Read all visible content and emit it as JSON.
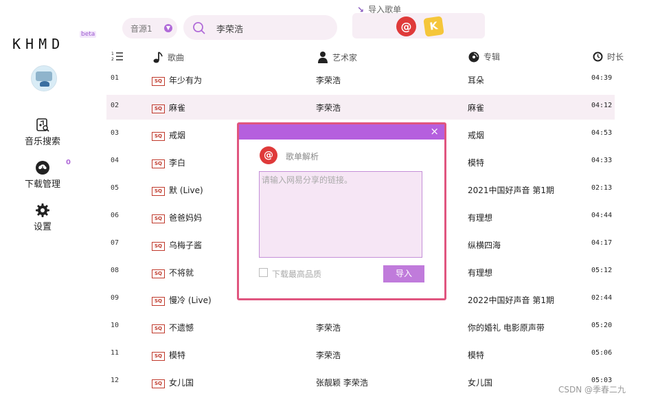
{
  "app": {
    "logo": "KHMD",
    "beta": "beta"
  },
  "sidebar": {
    "items": [
      {
        "label": "音乐搜索",
        "icon": "music-search-icon"
      },
      {
        "label": "下载管理",
        "icon": "cloud-download-icon",
        "badge": "0"
      },
      {
        "label": "设置",
        "icon": "gear-icon"
      }
    ]
  },
  "topbar": {
    "source": "音源1",
    "search_value": "李荣浩",
    "import_label": "导入歌单"
  },
  "table": {
    "headers": {
      "title": "歌曲",
      "artist": "艺术家",
      "album": "专辑",
      "duration": "时长"
    },
    "quality_badge": "SQ",
    "rows": [
      {
        "num": "01",
        "title": "年少有为",
        "artist": "李荣浩",
        "album": "耳朵",
        "duration": "04:39"
      },
      {
        "num": "02",
        "title": "麻雀",
        "artist": "李荣浩",
        "album": "麻雀",
        "duration": "04:12"
      },
      {
        "num": "03",
        "title": "戒烟",
        "artist": "",
        "album": "戒烟",
        "duration": "04:53"
      },
      {
        "num": "04",
        "title": "李白",
        "artist": "",
        "album": "模特",
        "duration": "04:33"
      },
      {
        "num": "05",
        "title": "默 (Live)",
        "artist": "",
        "album": "2021中国好声音 第1期",
        "duration": "02:13"
      },
      {
        "num": "06",
        "title": "爸爸妈妈",
        "artist": "",
        "album": "有理想",
        "duration": "04:44"
      },
      {
        "num": "07",
        "title": "乌梅子酱",
        "artist": "",
        "album": "纵横四海",
        "duration": "04:17"
      },
      {
        "num": "08",
        "title": "不将就",
        "artist": "",
        "album": "有理想",
        "duration": "05:12"
      },
      {
        "num": "09",
        "title": "慢冷 (Live)",
        "artist": "",
        "album": "2022中国好声音 第1期",
        "duration": "02:44"
      },
      {
        "num": "10",
        "title": "不遗憾",
        "artist": "李荣浩",
        "album": "你的婚礼 电影原声带",
        "duration": "05:20"
      },
      {
        "num": "11",
        "title": "模特",
        "artist": "李荣浩",
        "album": "模特",
        "duration": "05:06"
      },
      {
        "num": "12",
        "title": "女儿国",
        "artist": "张靓颖 李荣浩",
        "album": "女儿国",
        "duration": "05:03"
      }
    ]
  },
  "modal": {
    "title": "歌单解析",
    "placeholder": "请输入网易分享的链接。",
    "checkbox_label": "下载最高品质",
    "button": "导入",
    "close": "×"
  },
  "watermark": "CSDN @季春二九",
  "colors": {
    "accent": "#b55fde",
    "modal_border": "#e0557f",
    "netease_red": "#df3a3a",
    "kuwo_yellow": "#f5c63a"
  }
}
